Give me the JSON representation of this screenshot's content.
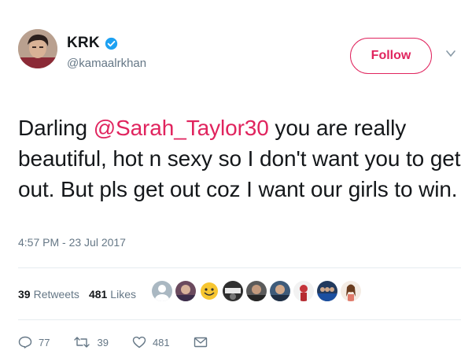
{
  "user": {
    "display_name": "KRK",
    "handle": "@kamaalrkhan",
    "verified": true,
    "avatar_icon": "profile-photo"
  },
  "follow_label": "Follow",
  "tweet": {
    "text_before_mention": "Darling ",
    "mention": "@Sarah_Taylor30",
    "text_after_mention": " you are really beautiful, hot n sexy so I don't want you to get out. But pls get out coz I want our girls to win.",
    "timestamp": "4:57 PM - 23 Jul 2017"
  },
  "stats": {
    "retweets_count": "39",
    "retweets_label": "Retweets",
    "likes_count": "481",
    "likes_label": "Likes",
    "liker_avatar_count": 9
  },
  "actions": {
    "reply_count": "77",
    "retweet_count": "39",
    "like_count": "481"
  },
  "colors": {
    "accent": "#e0245e",
    "verified_blue": "#1da1f2",
    "muted_text": "#657786",
    "text": "#14171a",
    "divider": "#e6ecf0"
  }
}
